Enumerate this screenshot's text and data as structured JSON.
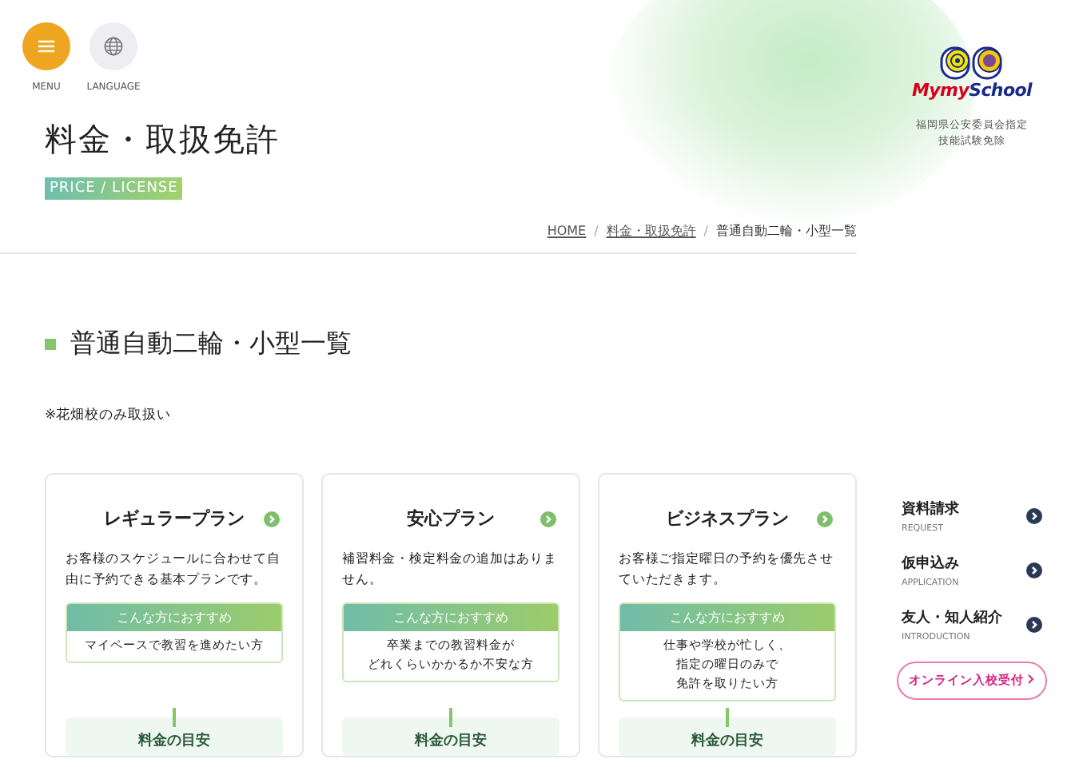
{
  "header": {
    "buttons": [
      {
        "kind": "menu",
        "label": "MENU"
      },
      {
        "kind": "language",
        "label": "LANGUAGE"
      }
    ]
  },
  "page_title": "料金・取扱免許",
  "page_tag": "PRICE / LICENSE",
  "breadcrumb_separator": "/",
  "breadcrumb": [
    {
      "label": "HOME",
      "link": true
    },
    {
      "label": "料金・取扱免許",
      "link": true
    },
    {
      "label": "普通自動二輪・小型一覧",
      "link": false
    }
  ],
  "section_title": "普通自動二輪・小型一覧",
  "note": "※花畑校のみ取扱い",
  "plans": [
    {
      "name": "レギュラープラン",
      "description": "お客様のスケジュールに合わせて自由に予約できる基本プランです。",
      "recommend_label": "こんな方におすすめ",
      "recommend_lines": [
        "マイペースで教習を進めたい方"
      ],
      "price_label": "料金の目安"
    },
    {
      "name": "安心プラン",
      "description": "補習料金・検定料金の追加はありません。",
      "recommend_label": "こんな方におすすめ",
      "recommend_lines": [
        "卒業までの教習料金が",
        "どれくらいかかるか不安な方"
      ],
      "price_label": "料金の目安"
    },
    {
      "name": "ビジネスプラン",
      "description": "お客様ご指定曜日の予約を優先させていただきます。",
      "recommend_label": "こんな方におすすめ",
      "recommend_lines": [
        "仕事や学校が忙しく、",
        "指定の曜日のみで",
        "免許を取りたい方"
      ],
      "price_label": "料金の目安"
    }
  ],
  "sidebar": {
    "logo_text_parts": [
      "Mymy",
      "School"
    ],
    "caption_lines": [
      "福岡県公安委員会指定",
      "技能試験免除"
    ],
    "links": [
      {
        "label": "資料請求",
        "sub": "REQUEST"
      },
      {
        "label": "仮申込み",
        "sub": "APPLICATION"
      },
      {
        "label": "友人・知人紹介",
        "sub": "INTRODUCTION"
      }
    ],
    "online_button": "オンライン入校受付"
  }
}
